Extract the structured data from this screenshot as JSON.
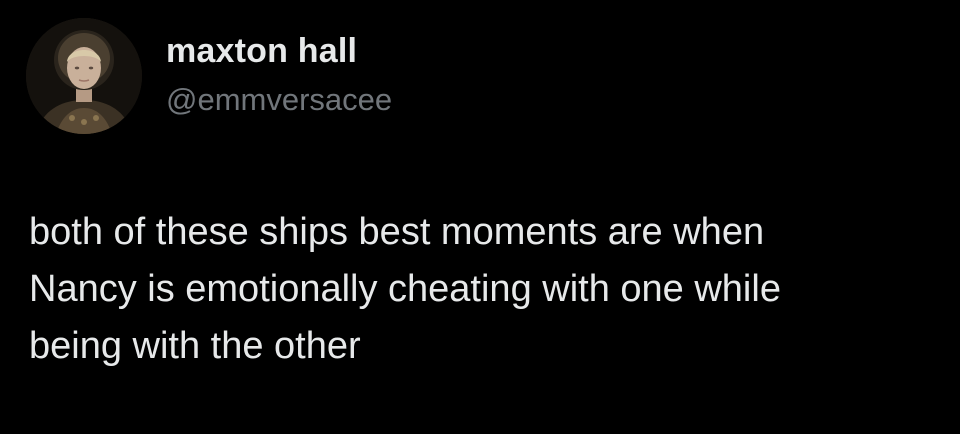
{
  "tweet": {
    "author": {
      "display_name": "maxton hall",
      "handle": "@emmversacee",
      "avatar_icon": "profile-photo-avatar"
    },
    "text": "both of these ships best moments are when\nNancy is emotionally cheating with one while\nbeing with the other"
  },
  "colors": {
    "background": "#000000",
    "primary_text": "#e7e9ea",
    "secondary_text": "#71767b"
  }
}
